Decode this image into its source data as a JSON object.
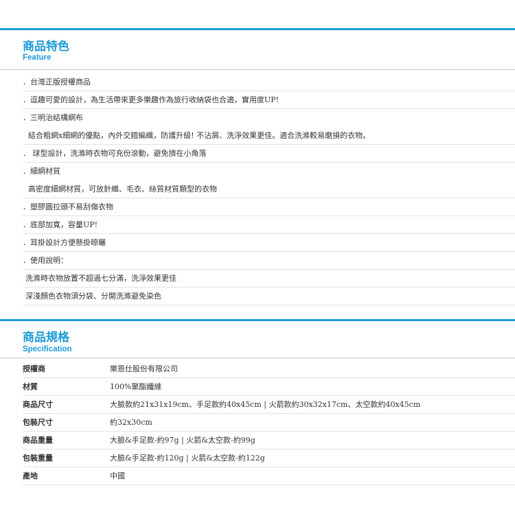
{
  "colors": {
    "accent": "#1c9ad6",
    "divider": "#e2e2e2",
    "text": "#333333"
  },
  "feature": {
    "title": "商品特色",
    "subtitle": "Feature",
    "rows": [
      "．台灣正版授權商品",
      "．逗趣可愛的設計，為生活帶來更多樂趣作為旅行收納袋也合適，實用度UP!",
      "．三明治結構網布",
      "結合粗網x細網的優點，內外交錯編織，防護升級! 不沾屑、洗淨效果更佳。適合洗滌較易磨損的衣物。",
      "． 球型設計，洗滌時衣物可充份滾動，避免擠在小角落",
      "．細網材質",
      "高密度細網材質，可放針織、毛衣、絲質材質類型的衣物",
      "．塑膠圓拉頭不易刮傷衣物",
      "．底部加寬，容量UP!",
      "．耳掛設計方便懸掛晾曬",
      "．使用說明：",
      "洗滌時衣物放置不超過七分滿，洗淨效果更佳",
      "深淺顏色衣物須分袋、分開洗滌避免染色"
    ]
  },
  "spec": {
    "title": "商品規格",
    "subtitle": "Specification",
    "rows": [
      {
        "label": "授權商",
        "value": "樂恩仕股份有限公司"
      },
      {
        "label": "材質",
        "value": "100%聚酯纖維"
      },
      {
        "label": "商品尺寸",
        "value": "大臉款約21x31x19cm、手足款約40x45cm | 火箭款約30x32x17cm、太空款約40x45cm"
      },
      {
        "label": "包裝尺寸",
        "value": "約32x30cm"
      },
      {
        "label": "商品重量",
        "value": "大臉&手足款-約97g | 火箭&太空款-約99g"
      },
      {
        "label": "包裝重量",
        "value": "大臉&手足款-約120g | 火箭&太空款-約122g"
      },
      {
        "label": "產地",
        "value": "中國"
      }
    ]
  }
}
